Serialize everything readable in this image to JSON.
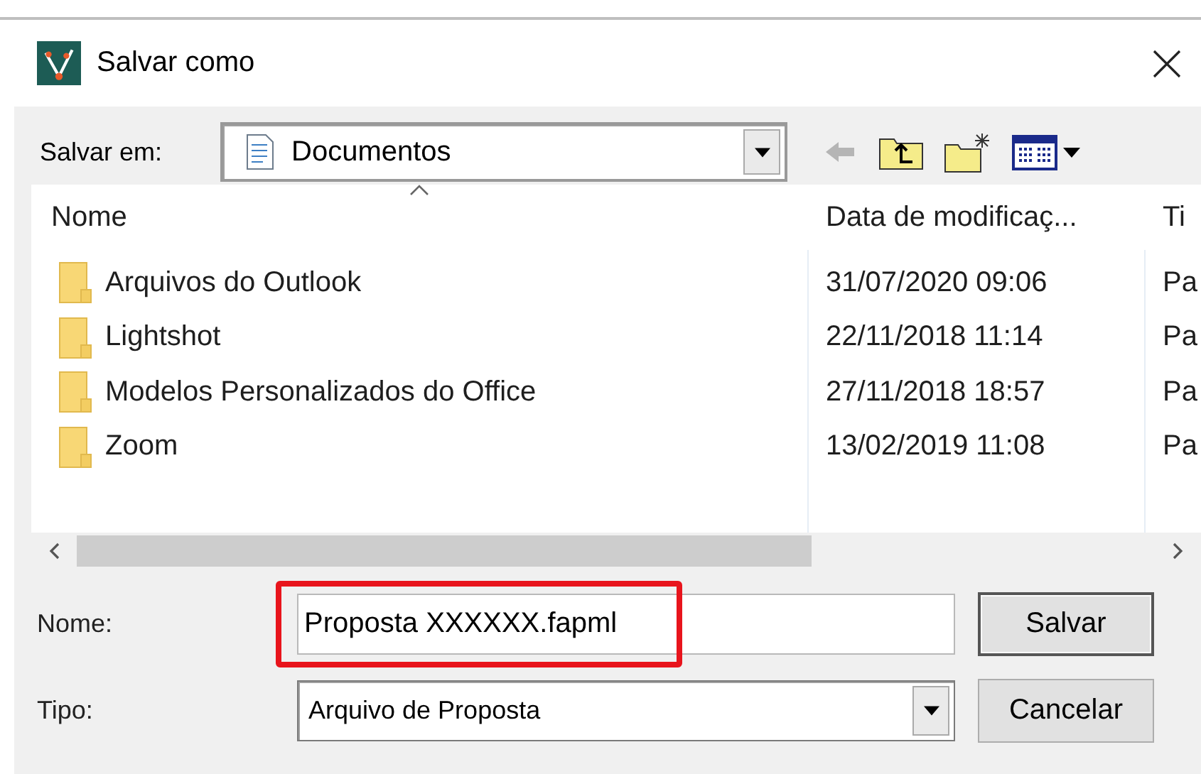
{
  "window": {
    "title": "Salvar como"
  },
  "location": {
    "label": "Salvar em:",
    "value": "Documentos"
  },
  "toolbar": [
    {
      "kind": "back",
      "disabled": true
    },
    {
      "kind": "up",
      "disabled": false
    },
    {
      "kind": "new-folder",
      "disabled": false
    },
    {
      "kind": "view-menu",
      "disabled": false
    }
  ],
  "file_list": {
    "columns": [
      {
        "label": "Nome",
        "sorted": true
      },
      {
        "label": "Data de modificaç...",
        "sorted": false
      },
      {
        "label": "Ti",
        "sorted": false
      }
    ],
    "rows": [
      {
        "name": "Arquivos do Outlook",
        "date": "31/07/2020 09:06",
        "type": "Pa"
      },
      {
        "name": "Lightshot",
        "date": "22/11/2018 11:14",
        "type": "Pa"
      },
      {
        "name": "Modelos Personalizados do Office",
        "date": "27/11/2018 18:57",
        "type": "Pa"
      },
      {
        "name": "Zoom",
        "date": "13/02/2019 11:08",
        "type": "Pa"
      }
    ]
  },
  "file_name": {
    "label": "Nome:",
    "value": "Proposta XXXXXX.fapml",
    "highlighted": true
  },
  "file_type": {
    "label": "Tipo:",
    "value": "Arquivo de Proposta"
  },
  "buttons": [
    {
      "label": "Salvar",
      "default": true
    },
    {
      "label": "Cancelar",
      "default": false
    }
  ]
}
